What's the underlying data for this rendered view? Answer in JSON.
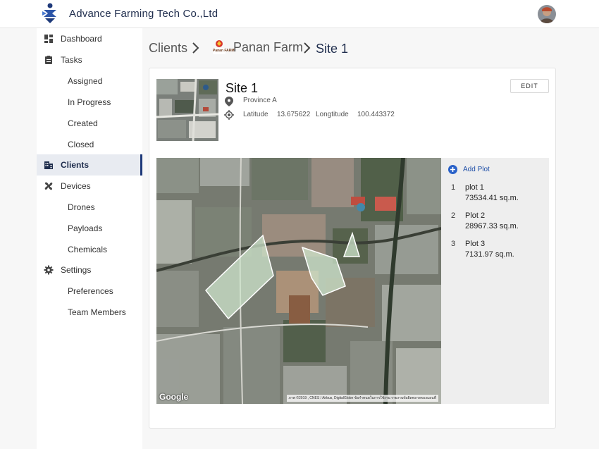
{
  "header": {
    "app_title": "Advance Farming Tech Co.,Ltd"
  },
  "sidebar": {
    "items": [
      {
        "label": "Dashboard",
        "icon": "dashboard-icon"
      },
      {
        "label": "Tasks",
        "icon": "clipboard-icon"
      },
      {
        "label": "Assigned"
      },
      {
        "label": "In Progress"
      },
      {
        "label": "Created"
      },
      {
        "label": "Closed"
      },
      {
        "label": "Clients",
        "icon": "building-icon",
        "active": true
      },
      {
        "label": "Devices",
        "icon": "drone-icon"
      },
      {
        "label": "Drones"
      },
      {
        "label": "Payloads"
      },
      {
        "label": "Chemicals"
      },
      {
        "label": "Settings",
        "icon": "gear-icon"
      },
      {
        "label": "Preferences"
      },
      {
        "label": "Team Members"
      }
    ]
  },
  "breadcrumb": {
    "clients": "Clients",
    "farm": "Panan Farm",
    "farm_logo_text": "Panan FARM",
    "site": "Site 1"
  },
  "site": {
    "title": "Site 1",
    "province": "Province A",
    "latitude_label": "Latitude",
    "latitude": "13.675622",
    "longitude_label": "Longtitude",
    "longitude": "100.443372",
    "edit_label": "EDIT"
  },
  "map": {
    "google_label": "Google",
    "attribution": "ภาพ ©2019 , CNES / Airbus, DigitalGlobe   ข้อกำหนดในการใช้งาน   รายงานข้อผิดพลาดของแผนที่"
  },
  "plots": {
    "add_label": "Add Plot",
    "items": [
      {
        "num": "1",
        "name": "plot 1",
        "area": "73534.41 sq.m."
      },
      {
        "num": "2",
        "name": "Plot 2",
        "area": "28967.33 sq.m."
      },
      {
        "num": "3",
        "name": "Plot 3",
        "area": "7131.97 sq.m."
      }
    ]
  },
  "colors": {
    "brand": "#1f2d4d",
    "accent_blue": "#1f4fa8",
    "sidebar_active_bg": "#e8ebf1"
  }
}
